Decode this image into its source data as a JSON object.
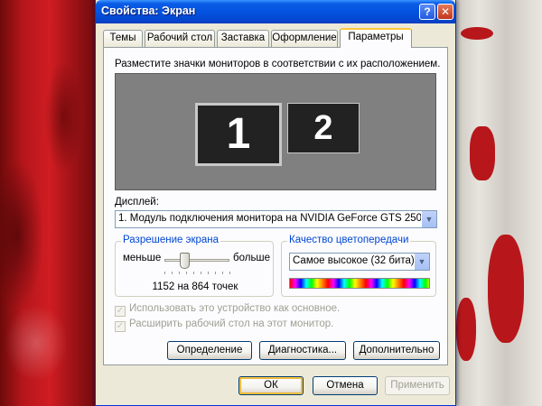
{
  "window": {
    "title": "Свойства: Экран",
    "help_glyph": "?",
    "close_glyph": "✕"
  },
  "tabs": [
    {
      "label": "Темы",
      "active": false
    },
    {
      "label": "Рабочий стол",
      "active": false
    },
    {
      "label": "Заставка",
      "active": false
    },
    {
      "label": "Оформление",
      "active": false
    },
    {
      "label": "Параметры",
      "active": true
    }
  ],
  "panel": {
    "instruction": "Разместите значки мониторов в соответствии с их расположением.",
    "monitors": [
      "1",
      "2"
    ],
    "display_label": "Дисплей:",
    "display_value": "1. Модуль подключения монитора на NVIDIA GeForce GTS 250",
    "dropdown_glyph": "▼"
  },
  "resolution": {
    "legend": "Разрешение экрана",
    "less_label": "меньше",
    "more_label": "больше",
    "value": "1152 на 864 точек",
    "slider_position_fraction": 0.3
  },
  "color_quality": {
    "legend": "Качество цветопередачи",
    "value": "Самое высокое (32 бита)"
  },
  "checkboxes": [
    {
      "label": "Использовать это устройство как основное.",
      "checked": true,
      "disabled": true
    },
    {
      "label": "Расширить рабочий стол на этот монитор.",
      "checked": true,
      "disabled": true
    }
  ],
  "panel_buttons": {
    "identify": "Определение",
    "troubleshoot": "Диагностика...",
    "advanced": "Дополнительно"
  },
  "dialog_buttons": {
    "ok": "ОК",
    "cancel": "Отмена",
    "apply": "Применить"
  },
  "colors": {
    "titlebar": "#0453e0",
    "group_legend": "#0046d5",
    "active_tab_accent": "#ffc83c"
  }
}
